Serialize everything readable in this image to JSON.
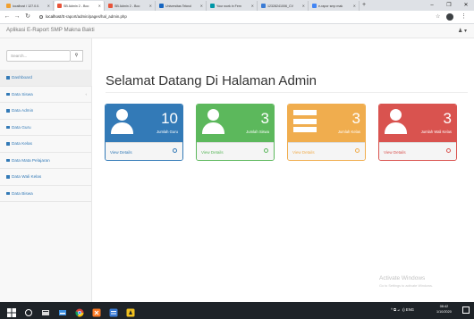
{
  "browser": {
    "tabs": [
      {
        "label": "localhost / 127.0.0.",
        "favicon_color": "#f0a030",
        "active": false
      },
      {
        "label": "SB Admin 2 - Boo",
        "favicon_color": "#e8543a",
        "active": true
      },
      {
        "label": "SB Admin 2 - Boo",
        "favicon_color": "#e8543a",
        "active": false
      },
      {
        "label": "Universitas Teknol",
        "favicon_color": "#1565c0",
        "active": false
      },
      {
        "label": "Your work in Fem",
        "favicon_color": "#0097a7",
        "active": false
      },
      {
        "label": "12328241006_CV",
        "favicon_color": "#3a7bd5",
        "active": false
      },
      {
        "label": "e-rapor smp mak",
        "favicon_color": "#4285f4",
        "active": false
      }
    ],
    "new_tab": "+",
    "window_controls": {
      "minimize": "–",
      "maximize": "❐",
      "close": "✕"
    },
    "url_host": "localhost",
    "url_path": "/E-raport/admin/pages/hal_admin.php"
  },
  "app": {
    "brand": "Aplikasi E-Raport SMP Makna Bakti",
    "user_menu": "♟ ▾"
  },
  "sidebar": {
    "search_placeholder": "Search...",
    "items": [
      {
        "label": "Dashboard",
        "active": true,
        "has_arrow": false
      },
      {
        "label": "Data Siswa",
        "active": false,
        "has_arrow": true
      },
      {
        "label": "Data Admin",
        "active": false,
        "has_arrow": false
      },
      {
        "label": "Data Guru",
        "active": false,
        "has_arrow": false
      },
      {
        "label": "Data Kelas",
        "active": false,
        "has_arrow": false
      },
      {
        "label": "Data Mata Pelajaran",
        "active": false,
        "has_arrow": false
      },
      {
        "label": "Data Wali Kelas",
        "active": false,
        "has_arrow": false
      },
      {
        "label": "Data Biswa",
        "active": false,
        "has_arrow": false
      }
    ]
  },
  "main": {
    "title": "Selamat Datang Di Halaman Admin",
    "panels": [
      {
        "count": "10",
        "label": "Jumlah Guru",
        "link": "View Details",
        "color": "#337ab7",
        "link_color": "#337ab7",
        "icon": "user-icon"
      },
      {
        "count": "3",
        "label": "Jumlah Siswa",
        "link": "View Details",
        "color": "#5cb85c",
        "link_color": "#5cb85c",
        "icon": "user-icon"
      },
      {
        "count": "3",
        "label": "Jumlah Kelas",
        "link": "View Details",
        "color": "#f0ad4e",
        "link_color": "#f0ad4e",
        "icon": "list-icon"
      },
      {
        "count": "3",
        "label": "Jumlah Wali Kelas",
        "link": "View Details",
        "color": "#d9534f",
        "link_color": "#d9534f",
        "icon": "user-icon"
      }
    ]
  },
  "watermark": {
    "line1": "Activate Windows",
    "line2": "Go to Settings to activate Windows."
  },
  "taskbar": {
    "tray": "^ ⧉ ⊿ ◁) ENG",
    "time": "08:42",
    "date": "1/10/2020"
  }
}
